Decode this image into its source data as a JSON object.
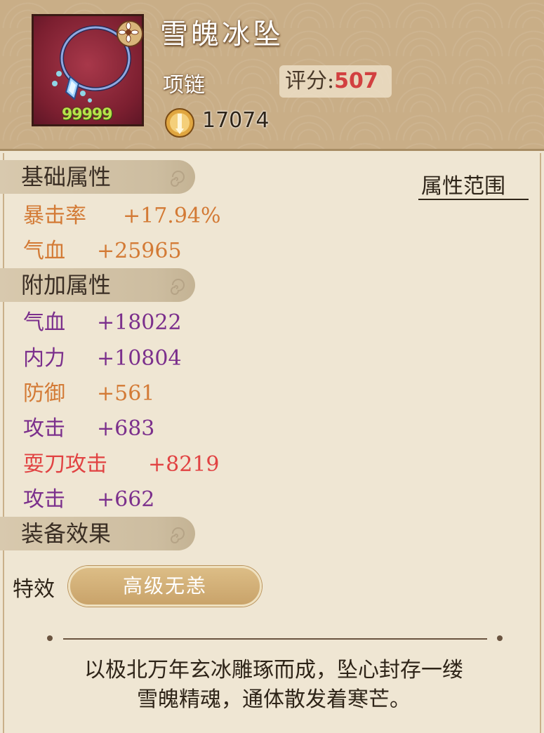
{
  "item": {
    "name": "雪魄冰坠",
    "type": "项链",
    "score_label": "评分:",
    "score_value": "507",
    "level_badge": "99999",
    "coin_value": "17074"
  },
  "sections": {
    "basic": "基础属性",
    "extra": "附加属性",
    "effect": "装备效果"
  },
  "attr_range_button": "属性范围",
  "basic_stats": [
    {
      "name": "暴击率",
      "value": "+17.94%",
      "color": "#d37a35"
    },
    {
      "name": "气血",
      "value": "+25965",
      "color": "#d37a35"
    }
  ],
  "extra_stats": [
    {
      "name": "气血",
      "value": "+18022",
      "color": "#7b2f8c"
    },
    {
      "name": "内力",
      "value": "+10804",
      "color": "#7b2f8c"
    },
    {
      "name": "防御",
      "value": "+561",
      "color": "#d37a35"
    },
    {
      "name": "攻击",
      "value": "+683",
      "color": "#7b2f8c"
    },
    {
      "name": "耍刀攻击",
      "value": "+8219",
      "color": "#e14242"
    },
    {
      "name": "攻击",
      "value": "+662",
      "color": "#7b2f8c"
    }
  ],
  "special": {
    "label": "特效",
    "effect": "高级无恙"
  },
  "description": {
    "line1": "以极北万年玄冰雕琢而成，坠心封存一缕",
    "line2": "雪魄精魂，通体散发着寒芒。"
  }
}
